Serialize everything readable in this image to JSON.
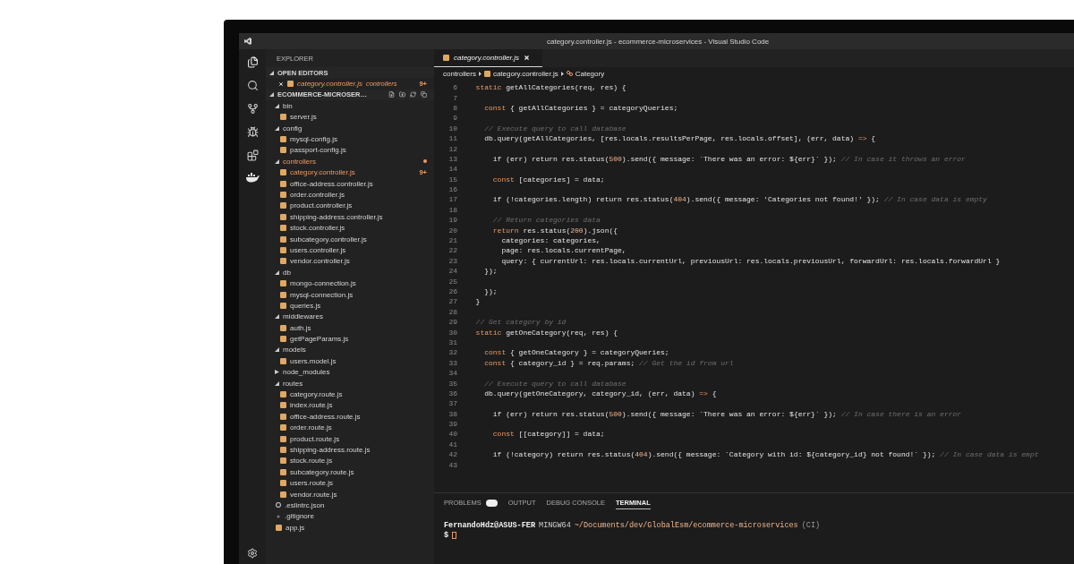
{
  "window": {
    "title": "category.controller.js - ecommerce-microservices - Visual Studio Code"
  },
  "sidebar": {
    "title": "EXPLORER",
    "open_editors": {
      "label": "OPEN EDITORS",
      "expanded": true,
      "items": [
        {
          "name": "category.controller.js",
          "folder": "controllers",
          "badge": "9+",
          "modified": true
        }
      ]
    },
    "project": {
      "label": "ECOMMERCE-MICROSER…",
      "expanded": true,
      "tree": [
        {
          "kind": "folder",
          "name": "bin",
          "expanded": true,
          "modified": false,
          "children": [
            {
              "kind": "js",
              "name": "server.js",
              "modified": false
            }
          ]
        },
        {
          "kind": "folder",
          "name": "config",
          "expanded": true,
          "modified": false,
          "children": [
            {
              "kind": "js",
              "name": "mysql-config.js",
              "modified": false
            },
            {
              "kind": "js",
              "name": "passport-config.js",
              "modified": false
            }
          ]
        },
        {
          "kind": "folder",
          "name": "controllers",
          "expanded": true,
          "modified": true,
          "children": [
            {
              "kind": "js",
              "name": "category.controller.js",
              "modified": true,
              "badge": "9+"
            },
            {
              "kind": "js",
              "name": "office-address.controller.js",
              "modified": false
            },
            {
              "kind": "js",
              "name": "order.controller.js",
              "modified": false
            },
            {
              "kind": "js",
              "name": "product.controller.js",
              "modified": false
            },
            {
              "kind": "js",
              "name": "shipping-address.controller.js",
              "modified": false
            },
            {
              "kind": "js",
              "name": "stock.controller.js",
              "modified": false
            },
            {
              "kind": "js",
              "name": "subcategory.controller.js",
              "modified": false
            },
            {
              "kind": "js",
              "name": "users.controller.js",
              "modified": false
            },
            {
              "kind": "js",
              "name": "vendor.controller.js",
              "modified": false
            }
          ]
        },
        {
          "kind": "folder",
          "name": "db",
          "expanded": true,
          "modified": false,
          "children": [
            {
              "kind": "js",
              "name": "mongo-connection.js",
              "modified": false
            },
            {
              "kind": "js",
              "name": "mysql-connection.js",
              "modified": false
            },
            {
              "kind": "js",
              "name": "queries.js",
              "modified": false
            }
          ]
        },
        {
          "kind": "folder",
          "name": "middlewares",
          "expanded": true,
          "modified": false,
          "children": [
            {
              "kind": "js",
              "name": "auth.js",
              "modified": false
            },
            {
              "kind": "js",
              "name": "getPageParams.js",
              "modified": false
            }
          ]
        },
        {
          "kind": "folder",
          "name": "models",
          "expanded": true,
          "modified": false,
          "children": [
            {
              "kind": "js",
              "name": "users.model.js",
              "modified": false
            }
          ]
        },
        {
          "kind": "folder",
          "name": "node_modules",
          "expanded": false,
          "modified": false
        },
        {
          "kind": "folder",
          "name": "routes",
          "expanded": true,
          "modified": false,
          "children": [
            {
              "kind": "js",
              "name": "category.route.js",
              "modified": false
            },
            {
              "kind": "js",
              "name": "index.route.js",
              "modified": false
            },
            {
              "kind": "js",
              "name": "office-address.route.js",
              "modified": false
            },
            {
              "kind": "js",
              "name": "order.route.js",
              "modified": false
            },
            {
              "kind": "js",
              "name": "product.route.js",
              "modified": false
            },
            {
              "kind": "js",
              "name": "shipping-address.route.js",
              "modified": false
            },
            {
              "kind": "js",
              "name": "stock.route.js",
              "modified": false
            },
            {
              "kind": "js",
              "name": "subcategory.route.js",
              "modified": false
            },
            {
              "kind": "js",
              "name": "users.route.js",
              "modified": false
            },
            {
              "kind": "js",
              "name": "vendor.route.js",
              "modified": false
            }
          ]
        },
        {
          "kind": "eslint",
          "name": ".eslintrc.json",
          "modified": false
        },
        {
          "kind": "git",
          "name": ".gitignore",
          "modified": false
        },
        {
          "kind": "js",
          "name": "app.js",
          "modified": false
        }
      ]
    }
  },
  "editor": {
    "tabs": [
      {
        "label": "category.controller.js",
        "selected": true
      }
    ],
    "breadcrumb": [
      {
        "kind": "folder",
        "label": "controllers"
      },
      {
        "kind": "js",
        "label": "category.controller.js"
      },
      {
        "kind": "symbol",
        "label": "Category"
      }
    ],
    "lines": [
      {
        "number": "6",
        "segments": [
          {
            "kind": "keyword",
            "text": "  static "
          },
          {
            "kind": "plain",
            "text": "getAllCategories(req, res) {"
          }
        ]
      },
      {
        "number": "7"
      },
      {
        "number": "8",
        "segments": [
          {
            "kind": "keyword",
            "text": "    const "
          },
          {
            "kind": "plain",
            "text": "{ getAllCategories } = categoryQueries;"
          }
        ]
      },
      {
        "number": "9"
      },
      {
        "number": "10",
        "segments": [
          {
            "kind": "comment",
            "text": "    // Execute query to call database"
          }
        ]
      },
      {
        "number": "11",
        "segments": [
          {
            "kind": "plain",
            "text": "    db.query(getAllCategories, [res.locals.resultsPerPage, res.locals.offset], (err, data) "
          },
          {
            "kind": "keyword",
            "text": "=>"
          },
          {
            "kind": "plain",
            "text": " {"
          }
        ]
      },
      {
        "number": "12"
      },
      {
        "number": "13",
        "segments": [
          {
            "kind": "plain",
            "text": "      if (err) return res.status("
          },
          {
            "kind": "number",
            "text": "500"
          },
          {
            "kind": "plain",
            "text": ").send({ message: `There was an error: ${err}` }); "
          },
          {
            "kind": "comment",
            "text": "// In case it throws an error"
          }
        ]
      },
      {
        "number": "14"
      },
      {
        "number": "15",
        "segments": [
          {
            "kind": "keyword",
            "text": "      const "
          },
          {
            "kind": "plain",
            "text": "[categories] = data;"
          }
        ]
      },
      {
        "number": "16"
      },
      {
        "number": "17",
        "segments": [
          {
            "kind": "plain",
            "text": "      if (!categories.length) return res.status("
          },
          {
            "kind": "number",
            "text": "404"
          },
          {
            "kind": "plain",
            "text": ").send({ message: 'Categories not found!' }); "
          },
          {
            "kind": "comment",
            "text": "// In case data is empty"
          }
        ]
      },
      {
        "number": "18"
      },
      {
        "number": "19",
        "segments": [
          {
            "kind": "comment",
            "text": "      // Return categories data"
          }
        ]
      },
      {
        "number": "20",
        "segments": [
          {
            "kind": "keyword",
            "text": "      return "
          },
          {
            "kind": "plain",
            "text": "res.status("
          },
          {
            "kind": "number",
            "text": "200"
          },
          {
            "kind": "plain",
            "text": ").json({"
          }
        ]
      },
      {
        "number": "21",
        "segments": [
          {
            "kind": "plain",
            "text": "        categories: categories,"
          }
        ]
      },
      {
        "number": "22",
        "segments": [
          {
            "kind": "plain",
            "text": "        page: res.locals.currentPage,"
          }
        ]
      },
      {
        "number": "23",
        "segments": [
          {
            "kind": "plain",
            "text": "        query: { currentUrl: res.locals.currentUrl, previousUrl: res.locals.previousUrl, forwardUrl: res.locals.forwardUrl }"
          }
        ]
      },
      {
        "number": "24",
        "segments": [
          {
            "kind": "plain",
            "text": "    });"
          }
        ]
      },
      {
        "number": "25"
      },
      {
        "number": "26",
        "segments": [
          {
            "kind": "plain",
            "text": "    });"
          }
        ]
      },
      {
        "number": "27",
        "segments": [
          {
            "kind": "plain",
            "text": "  }"
          }
        ]
      },
      {
        "number": "28"
      },
      {
        "number": "29",
        "segments": [
          {
            "kind": "comment",
            "text": "  // Get category by id"
          }
        ]
      },
      {
        "number": "30",
        "segments": [
          {
            "kind": "keyword",
            "text": "  static "
          },
          {
            "kind": "plain",
            "text": "getOneCategory(req, res) {"
          }
        ]
      },
      {
        "number": "31"
      },
      {
        "number": "32",
        "segments": [
          {
            "kind": "keyword",
            "text": "    const "
          },
          {
            "kind": "plain",
            "text": "{ getOneCategory } = categoryQueries;"
          }
        ]
      },
      {
        "number": "33",
        "segments": [
          {
            "kind": "keyword",
            "text": "    const "
          },
          {
            "kind": "plain",
            "text": "{ category_id } = req.params; "
          },
          {
            "kind": "comment",
            "text": "// Get the id from url"
          }
        ]
      },
      {
        "number": "34"
      },
      {
        "number": "35",
        "segments": [
          {
            "kind": "comment",
            "text": "    // Execute query to call database"
          }
        ]
      },
      {
        "number": "36",
        "segments": [
          {
            "kind": "plain",
            "text": "    db.query(getOneCategory, category_id, (err, data) "
          },
          {
            "kind": "keyword",
            "text": "=>"
          },
          {
            "kind": "plain",
            "text": " {"
          }
        ]
      },
      {
        "number": "37"
      },
      {
        "number": "38",
        "segments": [
          {
            "kind": "plain",
            "text": "      if (err) return res.status("
          },
          {
            "kind": "number",
            "text": "500"
          },
          {
            "kind": "plain",
            "text": ").send({ message: `There was an error: ${err}` }); "
          },
          {
            "kind": "comment",
            "text": "// In case there is an error"
          }
        ]
      },
      {
        "number": "39"
      },
      {
        "number": "40",
        "segments": [
          {
            "kind": "keyword",
            "text": "      const "
          },
          {
            "kind": "plain",
            "text": "[[category]] = data;"
          }
        ]
      },
      {
        "number": "41"
      },
      {
        "number": "42",
        "segments": [
          {
            "kind": "plain",
            "text": "      if (!category) return res.status("
          },
          {
            "kind": "number",
            "text": "404"
          },
          {
            "kind": "plain",
            "text": ").send({ message: `Category with id: ${category_id} not found!` }); "
          },
          {
            "kind": "comment",
            "text": "// In case data is empt"
          }
        ]
      },
      {
        "number": "43"
      }
    ]
  },
  "panel": {
    "tabs": [
      {
        "label": "PROBLEMS",
        "kind": "counted",
        "selected": false
      },
      {
        "label": "OUTPUT",
        "kind": "plain",
        "selected": false
      },
      {
        "label": "DEBUG CONSOLE",
        "kind": "plain",
        "selected": false
      },
      {
        "label": "TERMINAL",
        "kind": "plain",
        "selected": true
      }
    ],
    "terminal": {
      "prompt_line": [
        {
          "kind": "user",
          "text": "FernandoHdz@ASUS-FER"
        },
        {
          "kind": "system",
          "text": "MINGW64"
        },
        {
          "kind": "path",
          "text": "~/Documents/dev/GlobalEsm/ecommerce-microservices"
        },
        {
          "kind": "branch",
          "text": "(CI)"
        }
      ],
      "input_prompt": "$",
      "cursor": true
    }
  }
}
